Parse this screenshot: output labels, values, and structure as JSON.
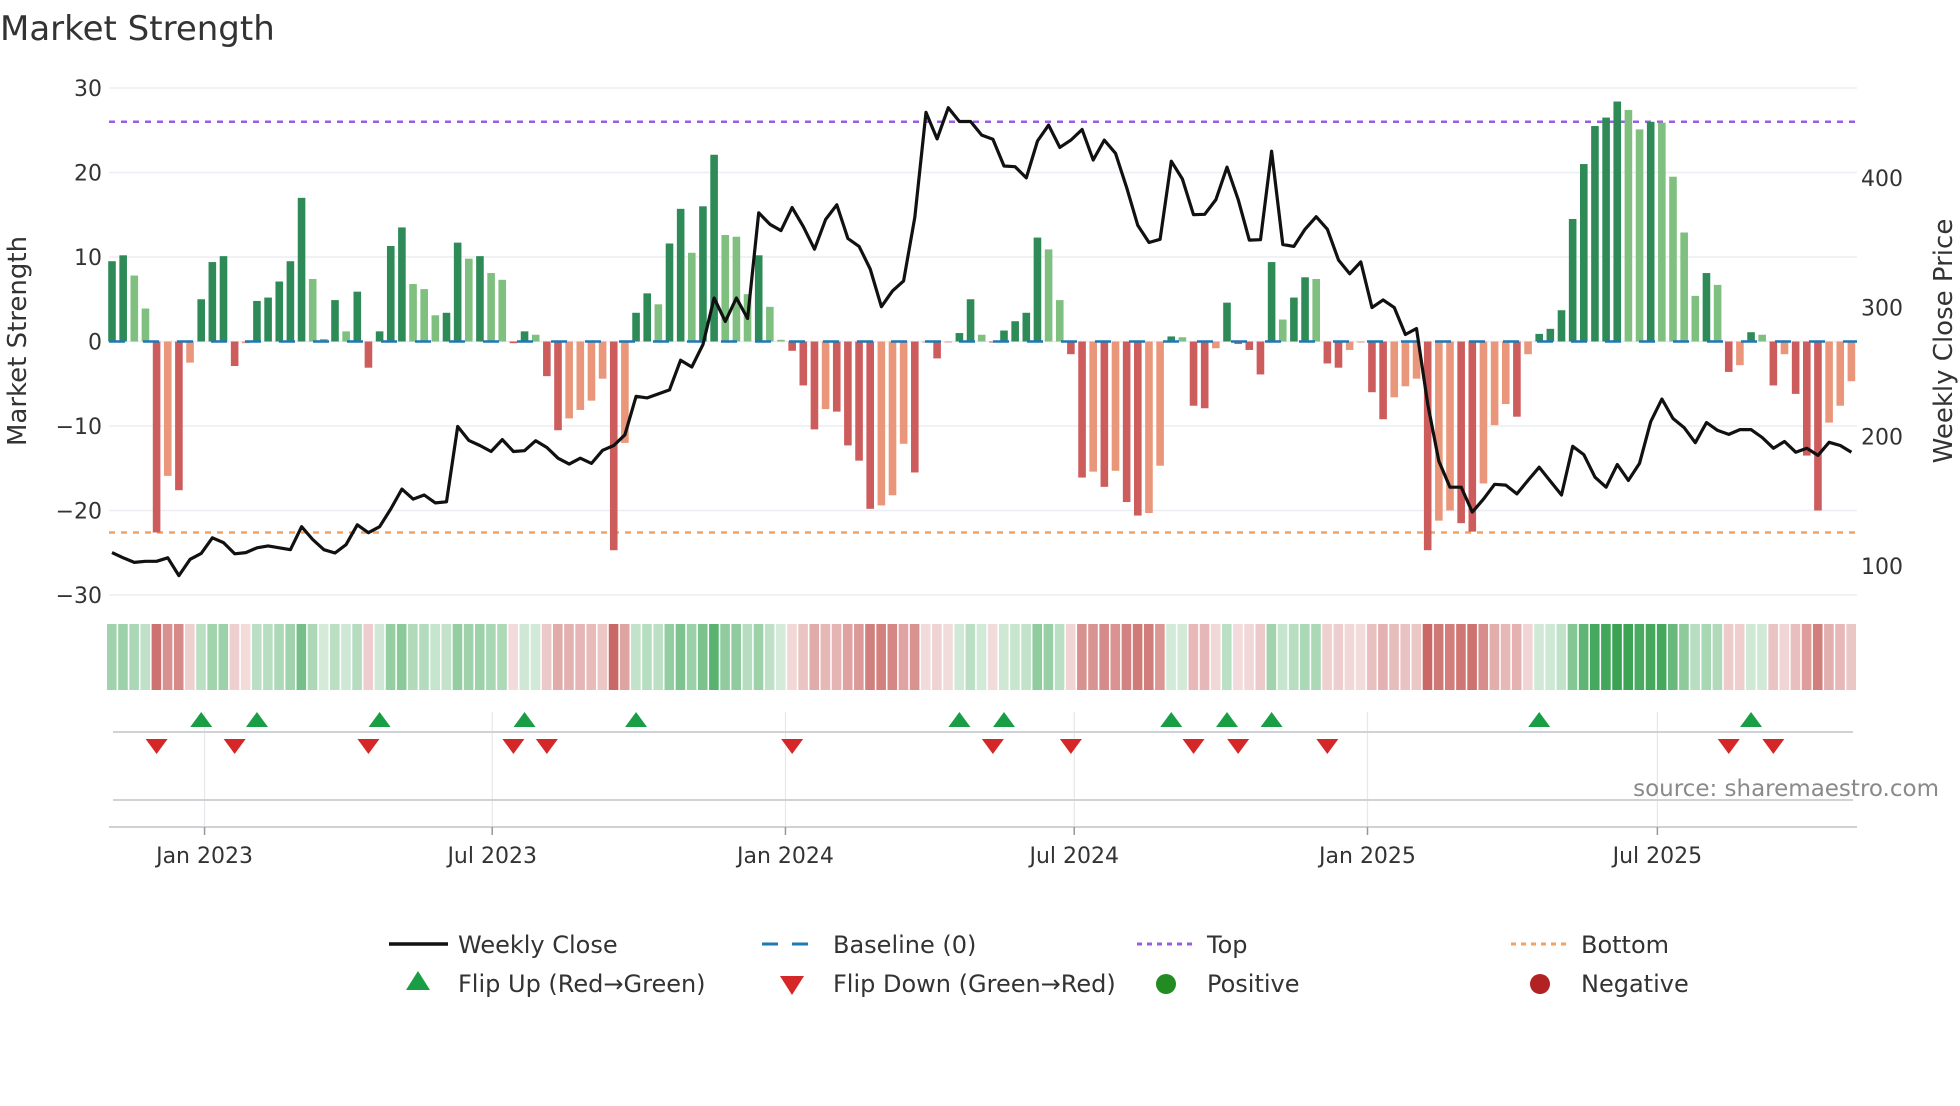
{
  "chart_data": {
    "type": "bar+line",
    "title": "Market Strength",
    "ylabel_left": "Market Strength",
    "ylabel_right": "Weekly Close Price",
    "ylim_left": [
      -30,
      30
    ],
    "ylim_right": [
      77.6,
      469.7
    ],
    "yticks_left": [
      30,
      20,
      10,
      0,
      -10,
      -20,
      -30
    ],
    "yticks_left_labels": [
      "30",
      "20",
      "10",
      "0",
      "−10",
      "−20",
      "−30"
    ],
    "yticks_right": [
      100,
      200,
      300,
      400
    ],
    "yticks_right_labels": [
      "100",
      "200",
      "300",
      "400"
    ],
    "xticks": [
      {
        "label": "Jan 2023",
        "week": 8.3
      },
      {
        "label": "Jul 2023",
        "week": 34.1
      },
      {
        "label": "Jan 2024",
        "week": 60.4
      },
      {
        "label": "Jul 2024",
        "week": 86.3
      },
      {
        "label": "Jan 2025",
        "week": 112.6
      },
      {
        "label": "Jul 2025",
        "week": 138.6
      }
    ],
    "top_level": 26,
    "bottom_level": -22.6,
    "baseline": 0,
    "strength": [
      9.5,
      10.2,
      7.8,
      3.9,
      -22.6,
      -15.9,
      -17.6,
      -2.5,
      5.0,
      9.4,
      10.1,
      -2.9,
      -0.2,
      4.8,
      5.2,
      7.1,
      9.5,
      17.0,
      7.4,
      0.3,
      4.9,
      1.2,
      5.9,
      -3.1,
      1.2,
      11.3,
      13.5,
      6.8,
      6.2,
      3.1,
      3.4,
      11.7,
      9.8,
      10.1,
      8.1,
      7.3,
      -0.2,
      1.2,
      0.8,
      -4.1,
      -10.5,
      -9.1,
      -8.1,
      -7.0,
      -4.4,
      -24.7,
      -12.0,
      3.4,
      5.7,
      4.4,
      11.6,
      15.7,
      10.5,
      16.0,
      22.1,
      12.6,
      12.4,
      5.6,
      10.2,
      4.1,
      0.2,
      -1.1,
      -5.2,
      -10.4,
      -8.0,
      -8.3,
      -12.3,
      -14.1,
      -19.8,
      -19.4,
      -18.2,
      -12.1,
      -15.5,
      -0.1,
      -2.0,
      -0.1,
      1.0,
      5.0,
      0.8,
      -0.1,
      1.3,
      2.4,
      3.4,
      12.3,
      10.9,
      4.9,
      -1.5,
      -16.1,
      -15.4,
      -17.2,
      -15.3,
      -19.0,
      -20.6,
      -20.3,
      -14.7,
      0.6,
      0.5,
      -7.6,
      -7.9,
      -0.8,
      4.6,
      -0.3,
      -1.0,
      -3.9,
      9.4,
      2.6,
      5.2,
      7.6,
      7.4,
      -2.6,
      -3.1,
      -1.0,
      -0.1,
      -6.0,
      -9.2,
      -6.6,
      -5.3,
      -4.4,
      -24.7,
      -21.2,
      -20.0,
      -21.5,
      -22.5,
      -16.8,
      -9.9,
      -7.4,
      -8.9,
      -1.5,
      0.9,
      1.5,
      3.7,
      14.5,
      21.0,
      25.5,
      26.5,
      28.4,
      27.4,
      25.1,
      26.0,
      25.9,
      19.5,
      12.9,
      5.4,
      8.1,
      6.7,
      -3.6,
      -2.8,
      1.1,
      0.8,
      -5.2,
      -1.5,
      -6.2,
      -13.5,
      -20.0,
      -9.6,
      -7.6,
      -4.7
    ],
    "close": [
      110.4,
      106.4,
      102.8,
      103.7,
      103.7,
      106.4,
      92.6,
      105.2,
      109.8,
      121.8,
      118.1,
      109.5,
      110.4,
      114.1,
      115.6,
      114.1,
      112.6,
      130.4,
      120.5,
      112.6,
      110.1,
      116.6,
      131.9,
      125.8,
      130.4,
      144.2,
      159.5,
      151.8,
      154.9,
      148.8,
      149.7,
      207.9,
      197.2,
      193.2,
      188.6,
      197.8,
      188.6,
      189.2,
      196.9,
      191.7,
      183.4,
      178.8,
      183.4,
      179.4,
      189.5,
      193.2,
      201.5,
      231.3,
      230.0,
      233.1,
      236.2,
      259.2,
      253.9,
      271.4,
      307.3,
      289.2,
      307.3,
      291.4,
      373.2,
      364.3,
      359.4,
      377.2,
      362.5,
      345.0,
      368.0,
      379.4,
      353.3,
      347.2,
      329.7,
      300.6,
      312.8,
      320.5,
      369.6,
      450.8,
      430.3,
      454.5,
      443.8,
      443.8,
      433.3,
      430.0,
      409.4,
      408.8,
      400.2,
      428.7,
      441.0,
      423.8,
      429.4,
      437.6,
      414.0,
      429.4,
      419.2,
      392.6,
      363.4,
      350.2,
      352.7,
      413.1,
      399.3,
      371.7,
      372.0,
      383.4,
      408.5,
      383.4,
      352.1,
      352.4,
      420.8,
      348.7,
      347.2,
      360.4,
      370.2,
      360.4,
      336.7,
      326.0,
      335.2,
      299.9,
      305.8,
      299.9,
      279.1,
      283.7,
      225.4,
      181.0,
      161.0,
      161.0,
      141.7,
      151.8,
      163.2,
      162.6,
      155.8,
      166.2,
      176.4,
      165.6,
      154.9,
      192.6,
      186.2,
      168.7,
      161.0,
      178.5,
      166.2,
      179.4,
      211.6,
      229.1,
      214.1,
      207.0,
      195.4,
      211.0,
      204.9,
      201.8,
      205.5,
      205.5,
      199.4,
      191.1,
      196.3,
      188.0,
      191.1,
      185.6,
      195.7,
      193.2,
      188.0
    ],
    "colors": {
      "rising_positive": "#2e8b57",
      "falling_positive": "#7fbf7f",
      "falling_negative": "#cd5c5c",
      "rising_negative": "#e9967a",
      "line": "#111111",
      "baseline": "#1f77b4",
      "top": "#9b5de5",
      "bottom": "#f4a261",
      "flip_up": "#1a9e45",
      "flip_down": "#d62728",
      "positive": "#228b22",
      "negative": "#b22222",
      "strip_positive": "#2f9e4a",
      "strip_negative": "#c0504d"
    },
    "legend": [
      {
        "label": "Weekly Close",
        "symbol": "line"
      },
      {
        "label": "Baseline (0)",
        "symbol": "dash"
      },
      {
        "label": "Top",
        "symbol": "dot-purple"
      },
      {
        "label": "Bottom",
        "symbol": "dot-orange"
      },
      {
        "label": "Flip Up (Red→Green)",
        "symbol": "triangle-up"
      },
      {
        "label": "Flip Down (Green→Red)",
        "symbol": "triangle-down"
      },
      {
        "label": "Positive",
        "symbol": "circle-green"
      },
      {
        "label": "Negative",
        "symbol": "circle-red"
      }
    ],
    "legend_position": "bottom",
    "source": "source: sharemaestro.com"
  }
}
